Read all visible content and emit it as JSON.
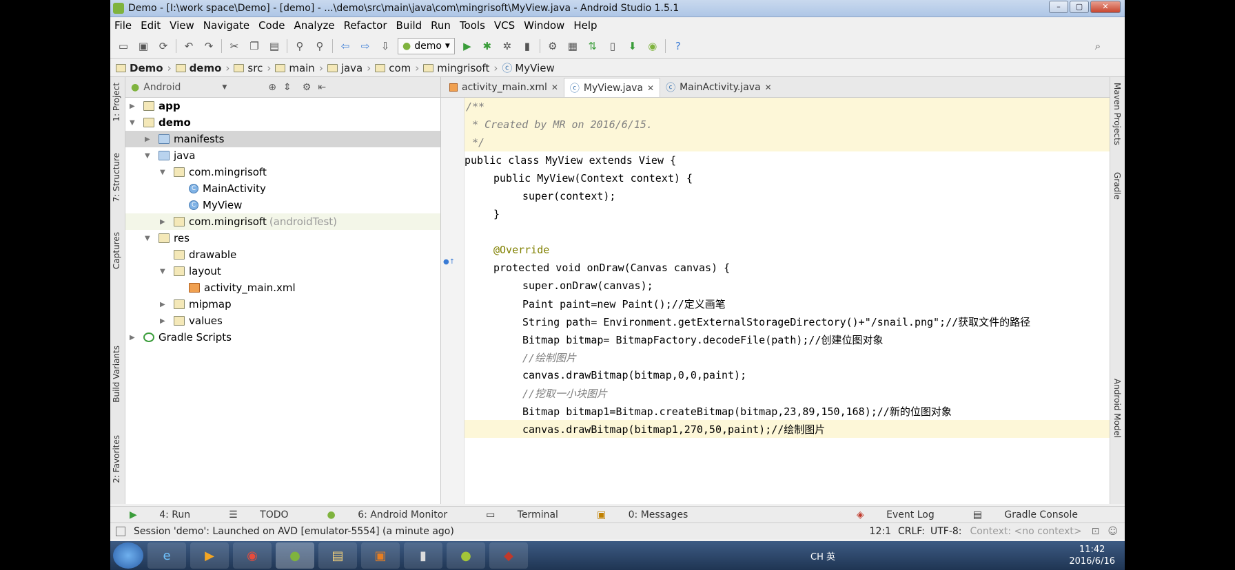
{
  "window": {
    "title": "Demo - [I:\\work space\\Demo] - [demo] - ...\\demo\\src\\main\\java\\com\\mingrisoft\\MyView.java - Android Studio 1.5.1"
  },
  "menu": [
    "File",
    "Edit",
    "View",
    "Navigate",
    "Code",
    "Analyze",
    "Refactor",
    "Build",
    "Run",
    "Tools",
    "VCS",
    "Window",
    "Help"
  ],
  "toolbar": {
    "run_config": "demo"
  },
  "breadcrumb": [
    "Demo",
    "demo",
    "src",
    "main",
    "java",
    "com",
    "mingrisoft",
    "MyView"
  ],
  "left_tabs": [
    "1: Project",
    "7: Structure",
    "Captures",
    "Build Variants",
    "2: Favorites"
  ],
  "right_tabs": [
    "Maven Projects",
    "Gradle",
    "Android Model"
  ],
  "project": {
    "view": "Android",
    "tree": [
      {
        "label": "app",
        "bold": true
      },
      {
        "label": "demo",
        "bold": true
      },
      {
        "label": "manifests"
      },
      {
        "label": "java"
      },
      {
        "label": "com.mingrisoft"
      },
      {
        "label": "MainActivity"
      },
      {
        "label": "MyView"
      },
      {
        "label": "com.mingrisoft",
        "suffix": "(androidTest)"
      },
      {
        "label": "res"
      },
      {
        "label": "drawable"
      },
      {
        "label": "layout"
      },
      {
        "label": "activity_main.xml"
      },
      {
        "label": "mipmap"
      },
      {
        "label": "values"
      },
      {
        "label": "Gradle Scripts"
      }
    ]
  },
  "editor": {
    "tabs": [
      "activity_main.xml",
      "MyView.java",
      "MainActivity.java"
    ],
    "lines": [
      "/**",
      " * Created by MR on 2016/6/15.",
      " */",
      "public class MyView extends View {",
      "public MyView(Context context) {",
      "super(context);",
      "}",
      "",
      "@Override",
      "protected void onDraw(Canvas canvas) {",
      "super.onDraw(canvas);",
      "Paint paint=new Paint();//定义画笔",
      "String path= Environment.getExternalStorageDirectory()+\"/snail.png\";//获取文件的路径",
      "Bitmap bitmap= BitmapFactory.decodeFile(path);//创建位图对象",
      "//绘制图片",
      "canvas.drawBitmap(bitmap,0,0,paint);",
      "//挖取一小块图片",
      "Bitmap bitmap1=Bitmap.createBitmap(bitmap,23,89,150,168);//新的位图对象",
      "canvas.drawBitmap(bitmap1,270,50,paint);//绘制图片"
    ]
  },
  "bottom_tabs": [
    "4: Run",
    "TODO",
    "6: Android Monitor",
    "Terminal",
    "0: Messages",
    "Event Log",
    "Gradle Console"
  ],
  "status": {
    "message": "Session 'demo': Launched on AVD [emulator-5554] (a minute ago)",
    "position": "12:1",
    "line_sep": "CRLF:",
    "encoding": "UTF-8:",
    "context": "Context: <no context>"
  },
  "taskbar": {
    "time": "11:42",
    "date": "2016/6/16",
    "ime": "CH 英"
  }
}
